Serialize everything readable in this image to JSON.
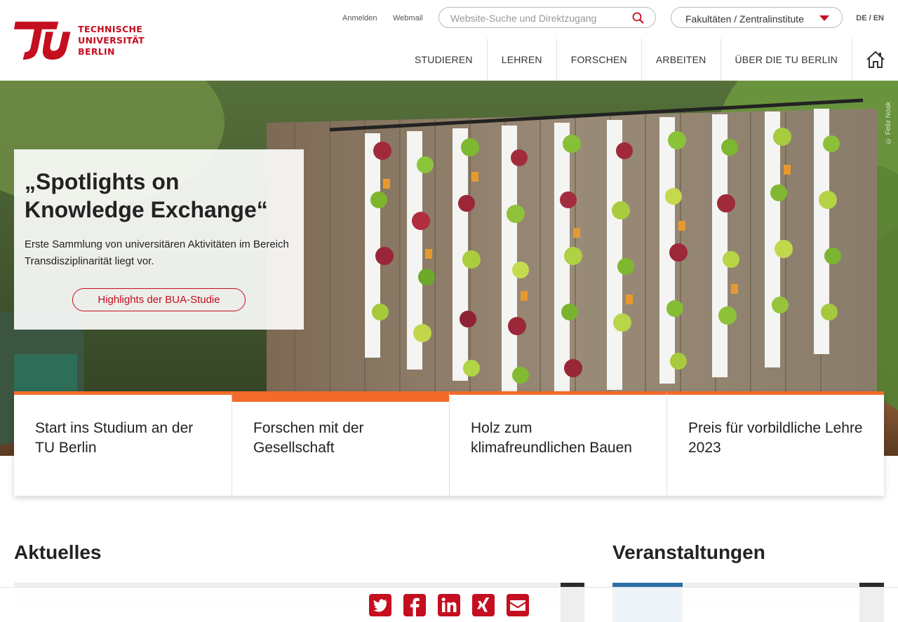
{
  "header": {
    "logo": {
      "line1": "TECHNISCHE",
      "line2": "UNIVERSITÄT",
      "line3": "BERLIN"
    },
    "meta_links": [
      "Anmelden",
      "Webmail"
    ],
    "search": {
      "placeholder": "Website-Suche und Direktzugang",
      "icon": "search-icon"
    },
    "faculty_select": {
      "label": "Fakultäten / Zentralinstitute",
      "icon": "caret-down-icon"
    },
    "lang": {
      "de": "DE",
      "separator": "/",
      "en": "EN"
    },
    "nav": [
      "STUDIEREN",
      "LEHREN",
      "FORSCHEN",
      "ARBEITEN",
      "ÜBER DIE TU BERLIN"
    ],
    "home_icon": "home-icon"
  },
  "hero": {
    "title": "„Spotlights on Knowledge Exchange“",
    "text": "Erste Sammlung von universitären Aktivitäten im Bereich Transdisziplinarität liegt vor.",
    "button": "Highlights der BUA-Studie",
    "credit": "© Felix Noak"
  },
  "cards": [
    {
      "title": "Start ins Studium an der TU Berlin",
      "active": false
    },
    {
      "title": "Forschen mit der Gesellschaft",
      "active": true
    },
    {
      "title": "Holz zum klimafreundlichen Bauen",
      "active": false
    },
    {
      "title": "Preis für vorbildliche Lehre 2023",
      "active": false
    }
  ],
  "sections": {
    "news": "Aktuelles",
    "events": "Veranstaltungen"
  },
  "share": [
    {
      "name": "twitter",
      "icon": "twitter-icon"
    },
    {
      "name": "facebook",
      "icon": "facebook-icon"
    },
    {
      "name": "linkedin",
      "icon": "linkedin-icon"
    },
    {
      "name": "xing",
      "icon": "xing-icon"
    },
    {
      "name": "email",
      "icon": "email-icon"
    }
  ],
  "colors": {
    "brand_red": "#c50e1f",
    "accent_orange": "#f26b2a",
    "share_red": "#c50e1f"
  }
}
